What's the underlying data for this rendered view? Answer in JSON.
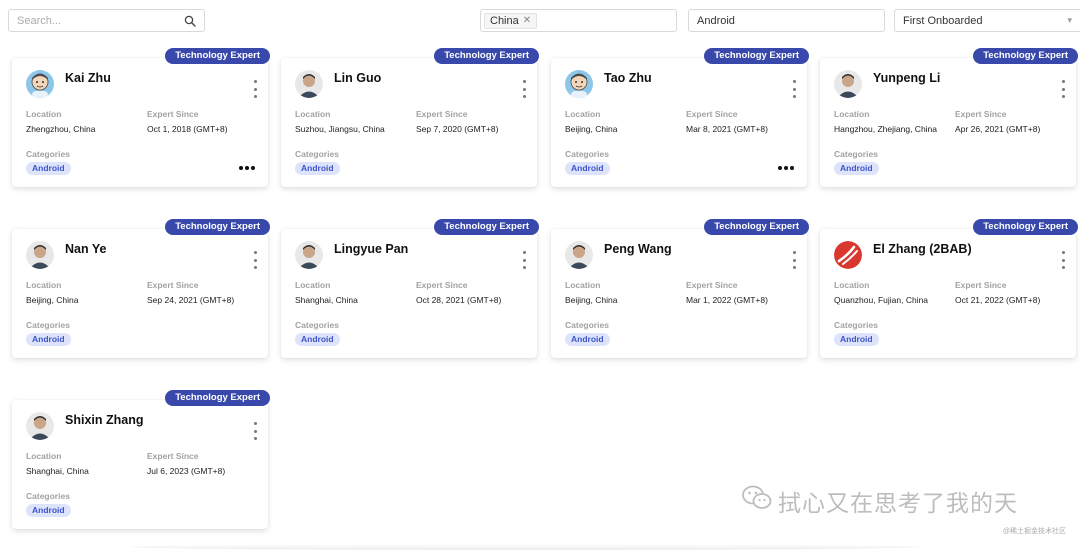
{
  "filters": {
    "search_placeholder": "Search...",
    "country_chip": "China",
    "category_value": "Android",
    "sort_value": "First Onboarded"
  },
  "labels": {
    "badge": "Technology Expert",
    "location": "Location",
    "expert_since": "Expert Since",
    "categories": "Categories"
  },
  "experts": [
    {
      "name": "Kai Zhu",
      "location": "Zhengzhou, China",
      "expert_since": "Oct 1, 2018 (GMT+8)",
      "category": "Android",
      "avatar": "cartoon-avatar"
    },
    {
      "name": "Lin Guo",
      "location": "Suzhou, Jiangsu, China",
      "expert_since": "Sep 7, 2020 (GMT+8)",
      "category": "Android",
      "avatar": "photo-avatar"
    },
    {
      "name": "Tao Zhu",
      "location": "Beijing, China",
      "expert_since": "Mar 8, 2021 (GMT+8)",
      "category": "Android",
      "avatar": "cartoon-avatar"
    },
    {
      "name": "Yunpeng Li",
      "location": "Hangzhou, Zhejiang, China",
      "expert_since": "Apr 26, 2021 (GMT+8)",
      "category": "Android",
      "avatar": "photo-avatar"
    },
    {
      "name": "Nan Ye",
      "location": "Beijing, China",
      "expert_since": "Sep 24, 2021 (GMT+8)",
      "category": "Android",
      "avatar": "photo-avatar"
    },
    {
      "name": "Lingyue Pan",
      "location": "Shanghai, China",
      "expert_since": "Oct 28, 2021 (GMT+8)",
      "category": "Android",
      "avatar": "photo-avatar"
    },
    {
      "name": "Peng Wang",
      "location": "Beijing, China",
      "expert_since": "Mar 1, 2022 (GMT+8)",
      "category": "Android",
      "avatar": "photo-avatar"
    },
    {
      "name": "El Zhang (2BAB)",
      "location": "Quanzhou, Fujian, China",
      "expert_since": "Oct 21, 2022 (GMT+8)",
      "category": "Android",
      "avatar": "logo-avatar"
    },
    {
      "name": "Shixin Zhang",
      "location": "Shanghai, China",
      "expert_since": "Jul 6, 2023 (GMT+8)",
      "category": "Android",
      "avatar": "photo-avatar"
    }
  ],
  "watermark": {
    "text": "拭心又在思考了我的天",
    "icon": "wechat-icon"
  },
  "footer_note": "@稀土掘金技术社区",
  "colors": {
    "badge": "#3849ab",
    "tag_bg": "#dde3fb",
    "tag_text": "#3d54c8"
  }
}
